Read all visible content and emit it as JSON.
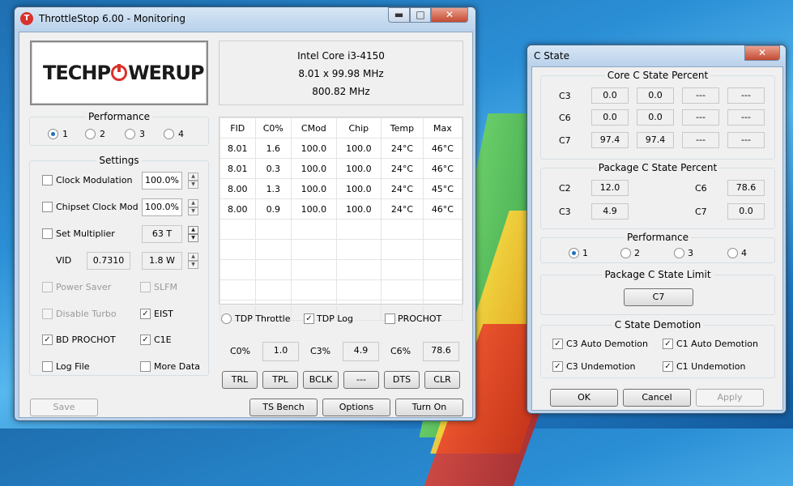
{
  "main_window": {
    "title": "ThrottleStop 6.00 - Monitoring",
    "app_icon_letter": "T",
    "logo": {
      "part1": "TECHP",
      "part2": "WERUP"
    },
    "cpu_info": {
      "name": "Intel Core i3-4150",
      "multiplier": "8.01 x 99.98 MHz",
      "frequency": "800.82 MHz"
    },
    "performance": {
      "label": "Performance",
      "options": [
        "1",
        "2",
        "3",
        "4"
      ],
      "selected": "1"
    },
    "settings": {
      "label": "Settings",
      "clock_modulation": {
        "label": "Clock Modulation",
        "value": "100.0%",
        "checked": false
      },
      "chipset_clock_mod": {
        "label": "Chipset Clock Mod",
        "value": "100.0%",
        "checked": false
      },
      "set_multiplier": {
        "label": "Set Multiplier",
        "value": "63 T",
        "checked": false
      },
      "vid": {
        "label": "VID",
        "value": "0.7310",
        "watts": "1.8 W"
      },
      "power_saver": {
        "label": "Power Saver",
        "checked": false
      },
      "slfm": {
        "label": "SLFM",
        "checked": false
      },
      "disable_turbo": {
        "label": "Disable Turbo",
        "checked": false
      },
      "eist": {
        "label": "EIST",
        "checked": true
      },
      "bd_prochot": {
        "label": "BD PROCHOT",
        "checked": true
      },
      "c1e": {
        "label": "C1E",
        "checked": true
      },
      "log_file": {
        "label": "Log File",
        "checked": false
      },
      "more_data": {
        "label": "More Data",
        "checked": false
      }
    },
    "table": {
      "headers": [
        "FID",
        "C0%",
        "CMod",
        "Chip",
        "Temp",
        "Max"
      ],
      "rows": [
        [
          "8.01",
          "1.6",
          "100.0",
          "100.0",
          "24°C",
          "46°C"
        ],
        [
          "8.01",
          "0.3",
          "100.0",
          "100.0",
          "24°C",
          "46°C"
        ],
        [
          "8.00",
          "1.3",
          "100.0",
          "100.0",
          "24°C",
          "45°C"
        ],
        [
          "8.00",
          "0.9",
          "100.0",
          "100.0",
          "24°C",
          "46°C"
        ]
      ]
    },
    "tdp_throttle": {
      "label": "TDP Throttle",
      "selected": false
    },
    "tdp_log": {
      "label": "TDP Log",
      "checked": true
    },
    "prochot": {
      "label": "PROCHOT",
      "checked": false
    },
    "cstates": {
      "c0_label": "C0%",
      "c0_value": "1.0",
      "c3_label": "C3%",
      "c3_value": "4.9",
      "c6_label": "C6%",
      "c6_value": "78.6"
    },
    "buttons_row": [
      "TRL",
      "TPL",
      "BCLK",
      "---",
      "DTS",
      "CLR"
    ],
    "save_label": "Save",
    "ts_bench_label": "TS Bench",
    "options_label": "Options",
    "turn_on_label": "Turn On"
  },
  "cstate_window": {
    "title": "C State",
    "core_group": {
      "label": "Core C State Percent",
      "rows": [
        {
          "label": "C3",
          "values": [
            "0.0",
            "0.0",
            "---",
            "---"
          ]
        },
        {
          "label": "C6",
          "values": [
            "0.0",
            "0.0",
            "---",
            "---"
          ]
        },
        {
          "label": "C7",
          "values": [
            "97.4",
            "97.4",
            "---",
            "---"
          ]
        }
      ]
    },
    "package_group": {
      "label": "Package C State Percent",
      "c2_label": "C2",
      "c2_value": "12.0",
      "c6_label": "C6",
      "c6_value": "78.6",
      "c3_label": "C3",
      "c3_value": "4.9",
      "c7_label": "C7",
      "c7_value": "0.0"
    },
    "performance": {
      "label": "Performance",
      "options": [
        "1",
        "2",
        "3",
        "4"
      ],
      "selected": "1"
    },
    "limit_group": {
      "label": "Package C State Limit",
      "value": "C7"
    },
    "demotion_group": {
      "label": "C State Demotion",
      "c3_auto": "C3 Auto Demotion",
      "c1_auto": "C1 Auto Demotion",
      "c3_undemotion": "C3 Undemotion",
      "c1_undemotion": "C1 Undemotion"
    },
    "ok_label": "OK",
    "cancel_label": "Cancel",
    "apply_label": "Apply"
  }
}
